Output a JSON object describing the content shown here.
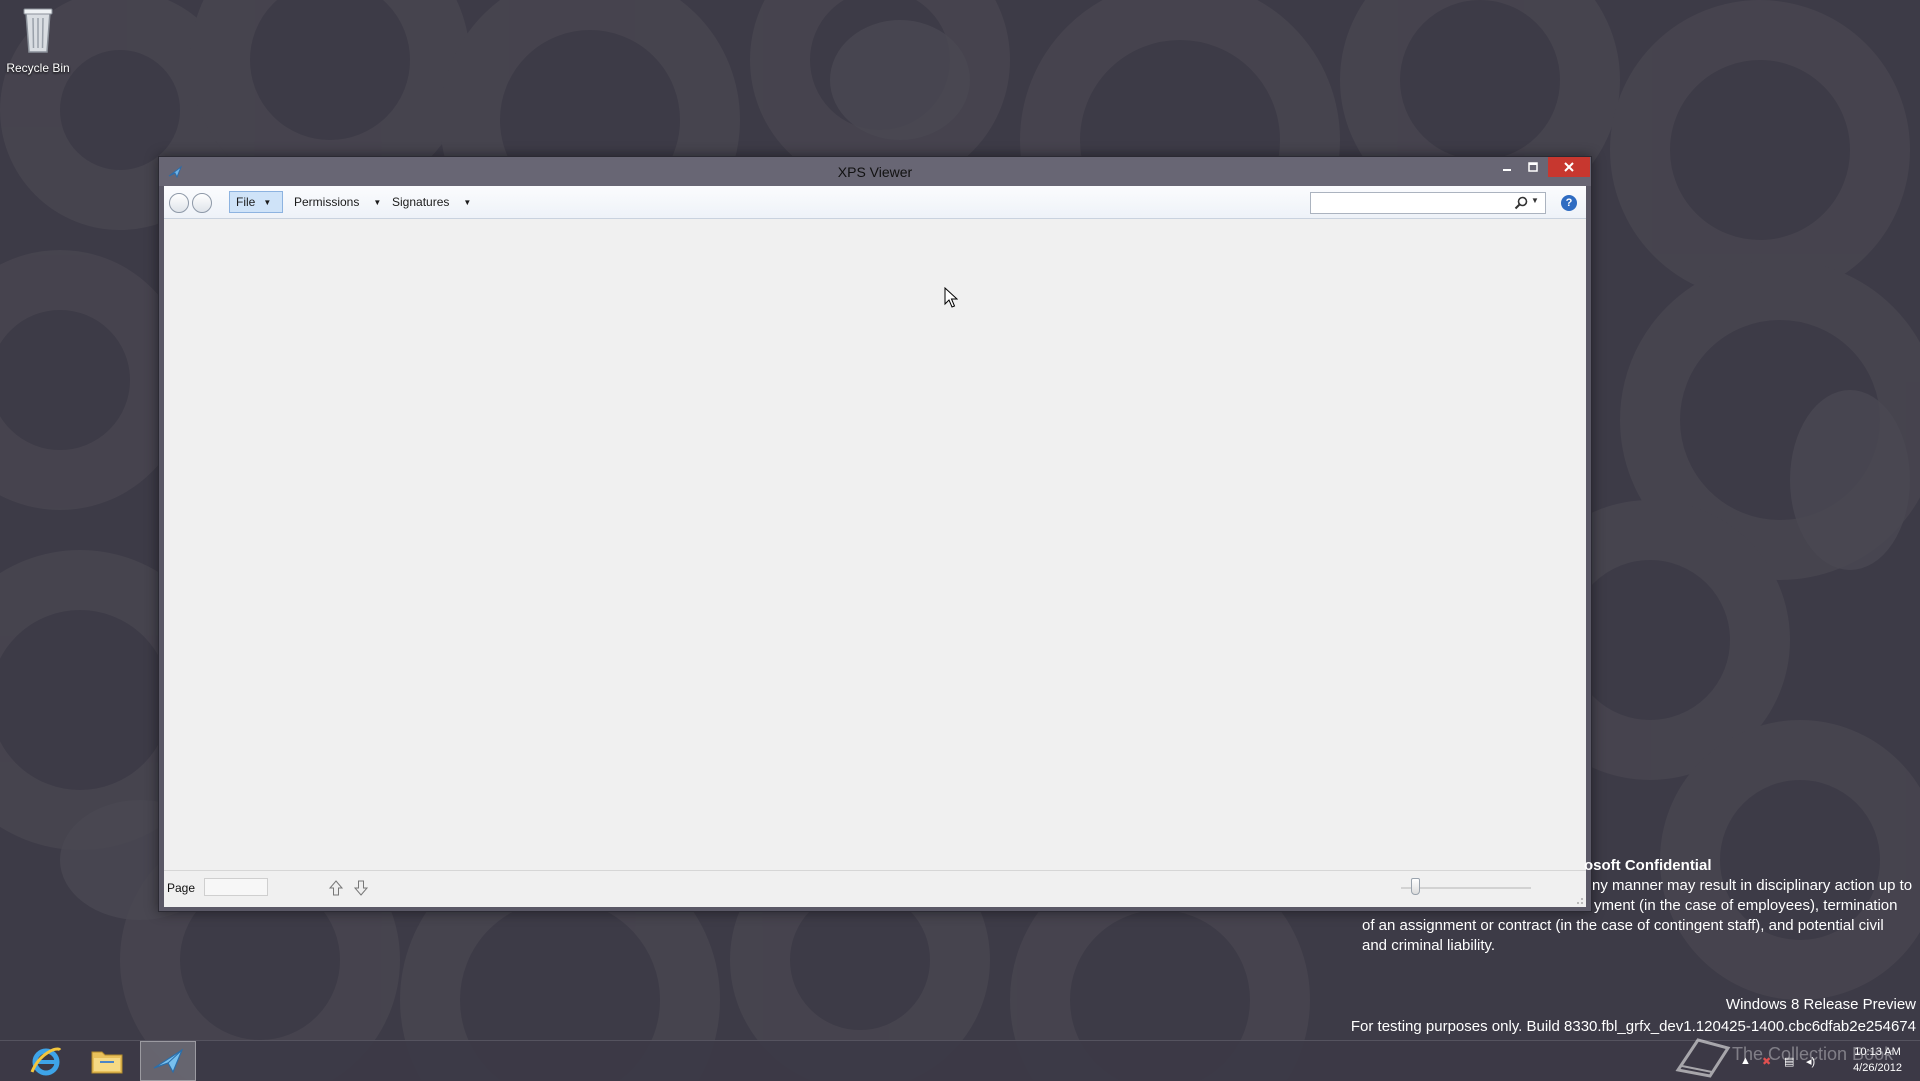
{
  "desktop": {
    "recycle_bin_label": "Recycle Bin"
  },
  "window": {
    "title": "XPS Viewer",
    "toolbar": {
      "file_label": "File",
      "permissions_label": "Permissions",
      "signatures_label": "Signatures",
      "search_value": "",
      "help_label": "?"
    },
    "statusbar": {
      "page_label": "Page",
      "page_value": ""
    }
  },
  "watermark": {
    "title": "osoft Confidential",
    "line1": "ny manner may result in disciplinary action up to",
    "line2": "yment (in the case of employees), termination",
    "line3": "of an assignment or contract (in the case of contingent staff), and potential civil",
    "line4": "and criminal liability."
  },
  "release": {
    "line1": "Windows 8 Release Preview",
    "line2": "For testing purposes only. Build 8330.fbl_grfx_dev1.120425-1400.cbc6dfab2e254674"
  },
  "taskbar": {
    "clock_time": "10:13 AM",
    "clock_date": "4/26/2012",
    "collection_text": "The Collection Book"
  }
}
